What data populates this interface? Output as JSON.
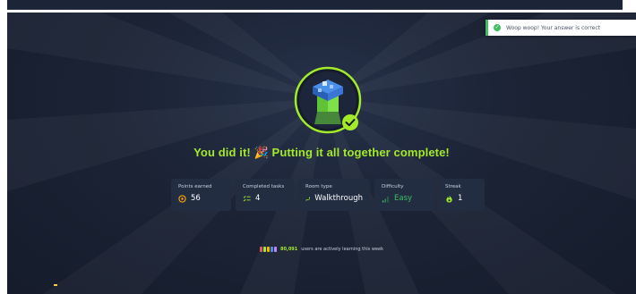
{
  "toast": {
    "message": "Woop woop! Your answer is correct",
    "icon": "check-circle-icon",
    "color": "#3fbf5f"
  },
  "badge": {
    "icon": "room-badge-icon",
    "check_icon": "check-icon",
    "ring_color": "#a3ea2a"
  },
  "headline": {
    "text_before": "You did it!",
    "emoji": "🎉",
    "text_after": "Putting it all together complete!",
    "color": "#a3ea2a"
  },
  "stats": [
    {
      "label": "Points earned",
      "value": "56",
      "icon": "target-icon"
    },
    {
      "label": "Completed tasks",
      "value": "4",
      "icon": "task-list-icon"
    },
    {
      "label": "Room type",
      "value": "Walkthrough",
      "icon": "walkthrough-icon"
    },
    {
      "label": "Difficulty",
      "value": "Easy",
      "icon": "signal-bars-icon"
    },
    {
      "label": "Streak",
      "value": "1",
      "icon": "flame-icon"
    }
  ],
  "learners": {
    "count": "80,091",
    "text": "users are actively learning this week"
  },
  "colors": {
    "accent": "#a3ea2a",
    "background": "#1b2335",
    "card": "#222d42",
    "success": "#3fbf5f"
  }
}
